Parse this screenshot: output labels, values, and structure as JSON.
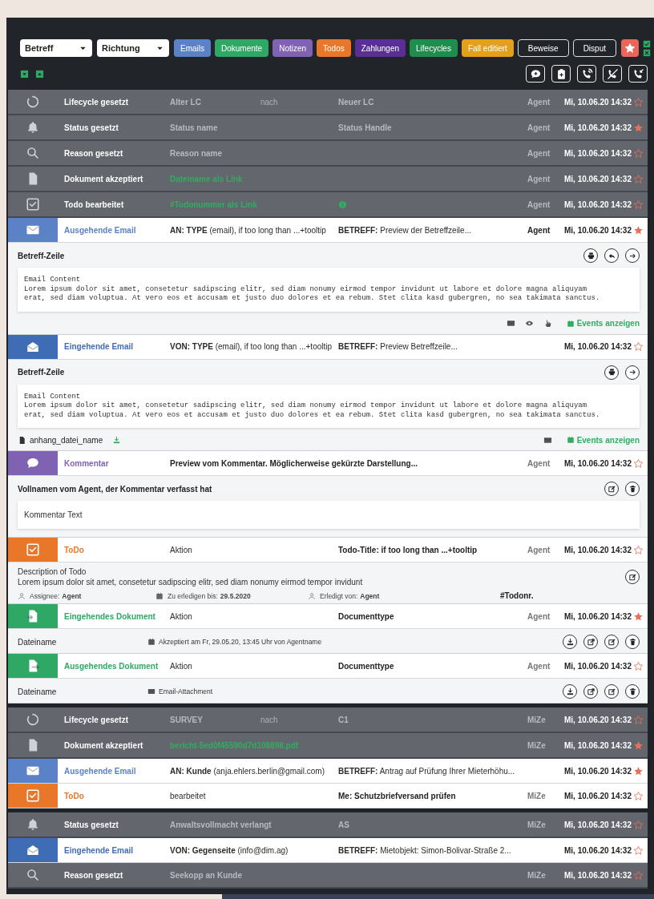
{
  "toolbar": {
    "selects": [
      {
        "label": "Betreff"
      },
      {
        "label": "Richtung"
      }
    ],
    "buttons": [
      {
        "label": "Emails",
        "kind": "filled",
        "color": "#5b82c6"
      },
      {
        "label": "Dokumente",
        "kind": "filled",
        "color": "#2fa866"
      },
      {
        "label": "Notizen",
        "kind": "filled",
        "color": "#8062b3"
      },
      {
        "label": "Todos",
        "kind": "filled",
        "color": "#e8772a"
      },
      {
        "label": "Zahlungen",
        "kind": "filled",
        "color": "#5a2f95"
      },
      {
        "label": "Lifecycles",
        "kind": "filled",
        "color": "#1e8e4e"
      },
      {
        "label": "Fall editiert",
        "kind": "filled",
        "color": "#e5a01b"
      },
      {
        "label": "Beweise",
        "kind": "outline"
      },
      {
        "label": "Disput",
        "kind": "outline"
      }
    ]
  },
  "groups": [
    {
      "entries": [
        {
          "kind": "lifecycle",
          "title": "Lifecycle gesetzt",
          "value": "Alter LC",
          "connector": "nach",
          "subject": "Neuer LC",
          "agent": "Agent",
          "date": "Mi, 10.06.20 14:32",
          "starred": false
        },
        {
          "kind": "status",
          "title": "Status gesetzt",
          "value": "Status name",
          "subject": "Status Handle",
          "agent": "Agent",
          "date": "Mi, 10.06.20 14:32",
          "starred": true
        },
        {
          "kind": "reason",
          "title": "Reason gesetzt",
          "value": "Reason name",
          "agent": "Agent",
          "date": "Mi, 10.06.20 14:32",
          "starred": false
        },
        {
          "kind": "document",
          "title": "Dokument akzeptiert",
          "value": "Dateiname als Link",
          "value_link": true,
          "agent": "Agent",
          "date": "Mi, 10.06.20 14:32",
          "starred": false
        },
        {
          "kind": "todoedit",
          "title": "Todo bearbeitet",
          "value": "#Todonummer als Link",
          "value_link": true,
          "info": true,
          "agent": "Agent",
          "date": "Mi, 10.06.20 14:32",
          "starred": false
        },
        {
          "kind": "outmail",
          "color": "#5b82c6",
          "title": "Ausgehende Email",
          "value": "**AN: TYPE** (email), if too long than ...+tooltip",
          "subject": "**BETREFF:** Preview der Betreffzeile...",
          "agent": "Agent",
          "agent_bold": true,
          "date": "Mi, 10.06.20 14:32",
          "starred": true,
          "detail": {
            "kind": "email",
            "subject": "Betreff-Zeile",
            "can_reply": true,
            "content": [
              "Email Content",
              "Lorem ipsum dolor sit amet, consetetur sadipscing elitr, sed diam nonumy eirmod tempor invidunt ut labore et dolore magna aliquyam erat, sed diam voluptua. At vero eos et accusam et justo duo dolores et ea rebum. Stet clita kasd gubergren, no sea takimata sanctus."
            ],
            "tracked": true,
            "events_link": "Events anzeigen"
          }
        },
        {
          "kind": "inmail",
          "color": "#3f6db5",
          "title": "Eingehende Email",
          "value": "**VON: TYPE** (email), if too long than ...+tooltip",
          "subject": "**BETREFF:** Preview Betreffzeile...",
          "date": "Mi, 10.06.20 14:32",
          "starred": false,
          "detail": {
            "kind": "email",
            "subject": "Betreff-Zeile",
            "can_reply": false,
            "content": [
              "Email Content",
              "Lorem ipsum dolor sit amet, consetetur sadipscing elitr, sed diam nonumy eirmod tempor invidunt ut labore et dolore magna aliquyam erat, sed diam voluptua. At vero eos et accusam et justo duo dolores et ea rebum. Stet clita kasd gubergren, no sea takimata sanctus."
            ],
            "attachment": "anhang_datei_name",
            "tracked": false,
            "events_link": "Events anzeigen"
          }
        },
        {
          "kind": "comment",
          "color": "#8062b3",
          "title": "Kommentar",
          "value": "Preview vom Kommentar. Möglicherweise gekürzte Darstellung...",
          "value_bold": true,
          "agent": "Agent",
          "date": "Mi, 10.06.20 14:32",
          "starred": false,
          "detail": {
            "kind": "comment",
            "author": "Vollnamen vom Agent, der Kommentar verfasst hat",
            "text": "Kommentar Text"
          }
        },
        {
          "kind": "todo",
          "color": "#e8772a",
          "title": "ToDo",
          "value": "Aktion",
          "subject": "Todo-Title: if too long than ...+tooltip",
          "subject_bold": true,
          "agent": "Agent",
          "date": "Mi, 10.06.20 14:32",
          "starred": false,
          "detail": {
            "kind": "todo",
            "title": "Description of Todo",
            "text": "Lorem ipsum dolor sit amet, consetetur sadipscing elitr, sed diam nonumy eirmod tempor invidunt",
            "meta": [
              {
                "label": "Assignee:",
                "value": "Agent"
              },
              {
                "label": "Zu erledigen bis:",
                "value": "29.5.2020"
              },
              {
                "label": "Erledigt von:",
                "value": "Agent"
              }
            ],
            "number": "#Todonr."
          }
        },
        {
          "kind": "indoc",
          "color": "#2fa866",
          "title": "Eingehendes Dokument",
          "value": "Aktion",
          "subject": "Documenttype",
          "subject_bold": true,
          "agent": "Agent",
          "date": "Mi, 10.06.20 14:32",
          "starred": true,
          "detail": {
            "kind": "accepted",
            "filename": "Dateiname",
            "note": "Akzeptiert am Fr, 29.05.20, 13:45 Uhr von Agentname"
          }
        },
        {
          "kind": "outdoc",
          "color": "#2fa866",
          "title": "Ausgehendes Dokument",
          "value": "Aktion",
          "subject": "Documenttype",
          "subject_bold": true,
          "agent": "Agent",
          "date": "Mi, 10.06.20 14:32",
          "starred": false,
          "detail": {
            "kind": "attachment",
            "filename": "Dateiname",
            "note": "Email-Attachment"
          }
        }
      ]
    },
    {
      "entries": [
        {
          "kind": "lifecycle",
          "title": "Lifecycle gesetzt",
          "value": "SURVEY",
          "connector": "nach",
          "subject": "C1",
          "agent": "MiZe",
          "date": "Mi, 10.06.20 14:32",
          "starred": false
        },
        {
          "kind": "document",
          "title": "Dokument akzeptiert",
          "value": "bericht-5ed0f45590d7d108898.pdf",
          "value_link": true,
          "agent": "MiZe",
          "date": "Mi, 10.06.20 14:32",
          "starred": true
        },
        {
          "kind": "outmail",
          "color": "#5b82c6",
          "title": "Ausgehende Email",
          "value": "**AN: Kunde** (anja.ehlers.berlin@gmail.com)",
          "subject": "**BETREFF:** Antrag auf Prüfung Ihrer Mieterhöhu...",
          "date": "Mi, 10.06.20 14:32",
          "starred": true
        },
        {
          "kind": "todo",
          "color": "#e8772a",
          "title": "ToDo",
          "value": "bearbeitet",
          "subject": "Me: Schutzbriefversand prüfen",
          "subject_bold": true,
          "agent": "MiZe",
          "date": "Mi, 10.06.20 14:32",
          "starred": false
        }
      ]
    },
    {
      "entries": [
        {
          "kind": "status",
          "title": "Status gesetzt",
          "value": "Anwaltsvollmacht verlangt",
          "subject": "AS",
          "agent": "MiZe",
          "date": "Mi, 10.06.20 14:32",
          "starred": false
        },
        {
          "kind": "inmail",
          "color": "#3f6db5",
          "title": "Eingehende Email",
          "value": "**VON: Gegenseite** (info@dim.ag)",
          "subject": "**BETREFF:** Mietobjekt: Simon-Bolivar-Straße 2...",
          "date": "Mi, 10.06.20 14:32",
          "starred": false
        },
        {
          "kind": "reason",
          "title": "Reason gesetzt",
          "value": "Seekopp an Kunde",
          "agent": "MiZe",
          "date": "Mi, 10.06.20 14:32",
          "starred": false
        }
      ]
    }
  ]
}
